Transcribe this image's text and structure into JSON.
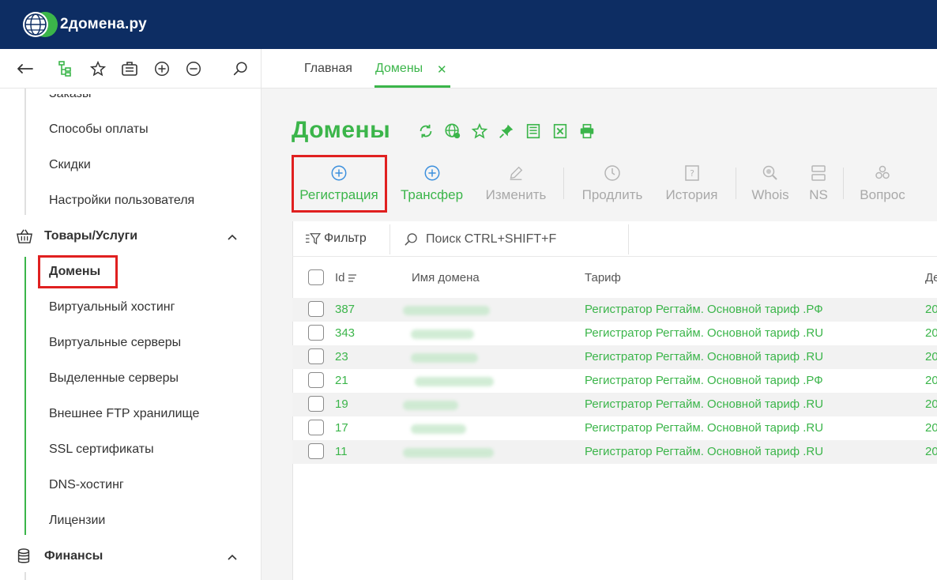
{
  "header": {
    "logo_text": "2домена.ру"
  },
  "toolbar": {
    "icons": [
      "back-arrow-icon",
      "tree-icon",
      "star-icon",
      "briefcase-icon",
      "zoom-in-icon",
      "zoom-out-icon",
      "search-icon"
    ],
    "tabs": [
      {
        "label": "Главная",
        "active": false
      },
      {
        "label": "Домены",
        "active": true,
        "close": "✕"
      }
    ]
  },
  "sidebar": {
    "partial_top_item": "Заказы",
    "items_top": [
      "Способы оплаты",
      "Скидки",
      "Настройки пользователя"
    ],
    "group_goods": {
      "label": "Товары/Услуги",
      "icon": "basket-icon"
    },
    "goods_items": [
      "Домены",
      "Виртуальный хостинг",
      "Виртуальные серверы",
      "Выделенные серверы",
      "Внешнее FTP хранилище",
      "SSL сертификаты",
      "DNS-хостинг",
      "Лицензии"
    ],
    "group_finance": {
      "label": "Финансы",
      "icon": "coins-icon"
    }
  },
  "main": {
    "title": "Домены",
    "title_icons": [
      "refresh-icon",
      "globe-icon",
      "star-icon",
      "pin-icon",
      "list-icon",
      "excel-icon",
      "print-icon"
    ],
    "actions": [
      {
        "label": "Регистрация",
        "icon": "plus-circle-icon",
        "enabled": true
      },
      {
        "label": "Трансфер",
        "icon": "plus-circle-icon",
        "enabled": true
      },
      {
        "label": "Изменить",
        "icon": "pencil-icon",
        "enabled": false
      },
      {
        "label": "Продлить",
        "icon": "clock-icon",
        "enabled": false
      },
      {
        "label": "История",
        "icon": "question-doc-icon",
        "enabled": false
      },
      {
        "label": "Whois",
        "icon": "whois-icon",
        "enabled": false
      },
      {
        "label": "NS",
        "icon": "server-icon",
        "enabled": false
      },
      {
        "label": "Вопрос",
        "icon": "people-icon",
        "enabled": false
      }
    ],
    "filter_label": "Фильтр",
    "search_placeholder": "Поиск CTRL+SHIFT+F",
    "columns": [
      "Id",
      "Имя домена",
      "Тариф",
      "Де"
    ],
    "rows": [
      {
        "id": "387",
        "tariff": "Регистратор Регтайм. Основной тариф .РФ",
        "date": "20"
      },
      {
        "id": "343",
        "tariff": "Регистратор Регтайм. Основной тариф .RU",
        "date": "20"
      },
      {
        "id": "23",
        "tariff": "Регистратор Регтайм. Основной тариф .RU",
        "date": "20"
      },
      {
        "id": "21",
        "tariff": "Регистратор Регтайм. Основной тариф .РФ",
        "date": "20"
      },
      {
        "id": "19",
        "tariff": "Регистратор Регтайм. Основной тариф .RU",
        "date": "20"
      },
      {
        "id": "17",
        "tariff": "Регистратор Регтайм. Основной тариф .RU",
        "date": "20"
      },
      {
        "id": "11",
        "tariff": "Регистратор Регтайм. Основной тариф .RU",
        "date": "20"
      }
    ]
  },
  "colors": {
    "header_bg": "#0d2d63",
    "accent": "#3bb54a",
    "highlight": "#e02020",
    "disabled": "#a9a9a9"
  }
}
